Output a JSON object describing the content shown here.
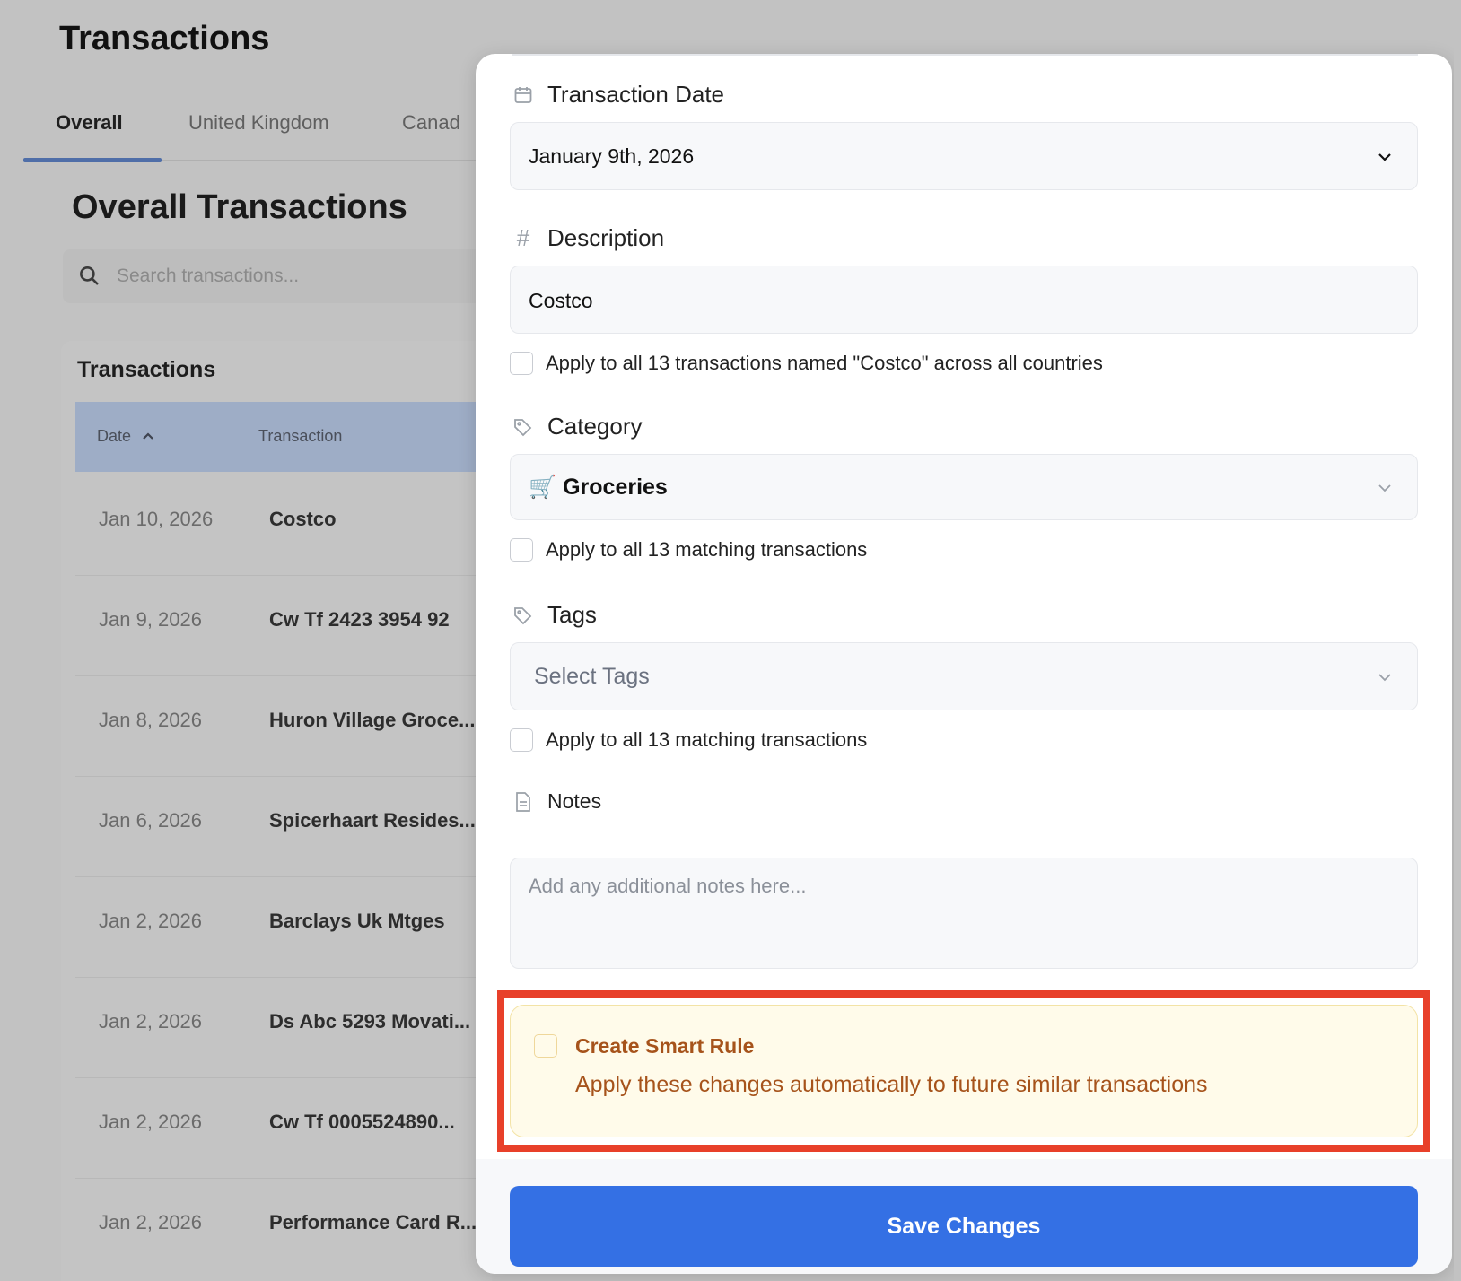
{
  "page": {
    "title": "Transactions"
  },
  "tabs": [
    {
      "label": "Overall",
      "active": true
    },
    {
      "label": "United Kingdom",
      "active": false
    },
    {
      "label": "Canad",
      "active": false
    }
  ],
  "section": {
    "title": "Overall Transactions"
  },
  "search": {
    "placeholder": "Search transactions..."
  },
  "table": {
    "title": "Transactions",
    "columns": [
      "Date",
      "Transaction"
    ],
    "rows": [
      {
        "date": "Jan 10, 2026",
        "transaction": "Costco"
      },
      {
        "date": "Jan 9, 2026",
        "transaction": "Cw Tf 2423 3954 92"
      },
      {
        "date": "Jan 8, 2026",
        "transaction": "Huron Village Groce..."
      },
      {
        "date": "Jan 6, 2026",
        "transaction": "Spicerhaart Resides..."
      },
      {
        "date": "Jan 2, 2026",
        "transaction": "Barclays Uk Mtges"
      },
      {
        "date": "Jan 2, 2026",
        "transaction": "Ds Abc 5293 Movati..."
      },
      {
        "date": "Jan 2, 2026",
        "transaction": "Cw Tf 0005524890..."
      },
      {
        "date": "Jan 2, 2026",
        "transaction": "Performance Card R..."
      }
    ]
  },
  "modal": {
    "date": {
      "label": "Transaction Date",
      "value": "January 9th, 2026"
    },
    "description": {
      "label": "Description",
      "value": "Costco",
      "apply_all": "Apply to all 13 transactions named \"Costco\" across all countries"
    },
    "category": {
      "label": "Category",
      "emoji": "🛒",
      "value": "Groceries",
      "apply_all": "Apply to all 13 matching transactions"
    },
    "tags": {
      "label": "Tags",
      "placeholder": "Select Tags",
      "apply_all": "Apply to all 13 matching transactions"
    },
    "notes": {
      "label": "Notes",
      "placeholder": "Add any additional notes here..."
    },
    "smart_rule": {
      "title": "Create Smart Rule",
      "subtitle": "Apply these changes automatically to future similar transactions"
    },
    "save_label": "Save Changes"
  },
  "colors": {
    "accent": "#3470e4",
    "highlight": "#e8402a",
    "smart_rule_bg": "#fffbea",
    "smart_rule_text": "#a6531b"
  }
}
